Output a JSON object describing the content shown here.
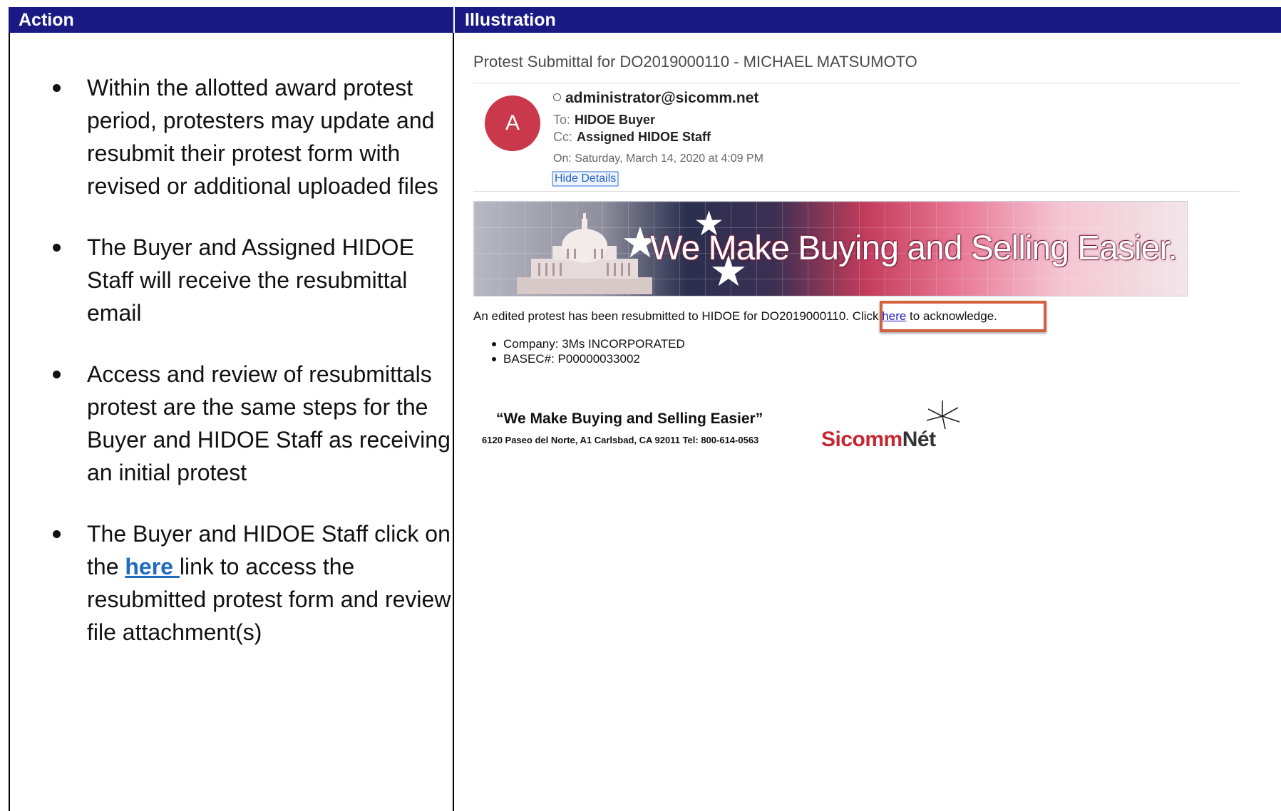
{
  "headers": {
    "action": "Action",
    "illustration": "Illustration"
  },
  "action": {
    "bullets": [
      {
        "text": "Within the allotted award protest period, protesters may update and resubmit their protest form with revised or additional uploaded files"
      },
      {
        "text": "The Buyer and Assigned HIDOE Staff will receive the resubmittal email"
      },
      {
        "text": "Access and review of resubmittals protest are the same steps for the Buyer and HIDOE Staff as receiving an initial protest"
      },
      {
        "pre": "The Buyer and HIDOE Staff click on the ",
        "link": "here ",
        "post": "link to access the resubmitted protest form and review file attachment(s)"
      }
    ]
  },
  "email": {
    "subject": "Protest Submittal for DO2019000110 - MICHAEL MATSUMOTO",
    "avatar_letter": "A",
    "from": "administrator@sicomm.net",
    "to_label": "To:",
    "to": "HIDOE Buyer",
    "cc_label": "Cc:",
    "cc": "Assigned HIDOE Staff",
    "date": "On: Saturday, March 14, 2020 at 4:09 PM",
    "hide_details": "Hide Details",
    "banner_text": "We Make Buying and Selling Easier.",
    "message_pre": "An edited protest has been resubmitted to HIDOE for DO2019000110. Click ",
    "message_link": "here",
    "message_post": " to acknowledge.",
    "facts": [
      "Company: 3Ms INCORPORATED",
      "BASEC#: P00000033002"
    ],
    "footer_slogan": "“We Make Buying and Selling Easier”",
    "footer_address": "6120 Paseo del Norte, A1  Carlsbad, CA 92011 Tel: 800-614-0563",
    "logo_part1": "Sicomm",
    "logo_part2": "Nét"
  }
}
